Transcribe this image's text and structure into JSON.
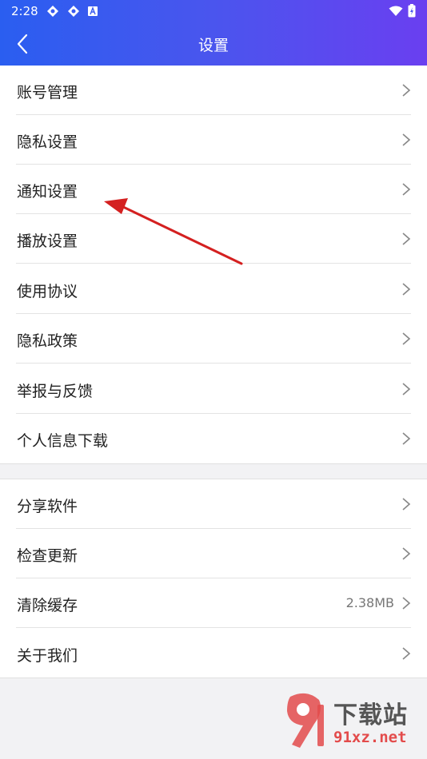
{
  "status_bar": {
    "time": "2:28",
    "icons": [
      "pinwheel-icon",
      "pinwheel-icon",
      "app-a-icon",
      "wifi-icon",
      "battery-charging-icon"
    ]
  },
  "header": {
    "title": "设置",
    "back_icon": "chevron-left-icon",
    "gradient": [
      "#2a5ef0",
      "#6a3ff0"
    ]
  },
  "group1": [
    {
      "label": "账号管理"
    },
    {
      "label": "隐私设置"
    },
    {
      "label": "通知设置"
    },
    {
      "label": "播放设置"
    },
    {
      "label": "使用协议"
    },
    {
      "label": "隐私政策"
    },
    {
      "label": "举报与反馈"
    },
    {
      "label": "个人信息下载"
    }
  ],
  "group2": [
    {
      "label": "分享软件"
    },
    {
      "label": "检查更新"
    },
    {
      "label": "清除缓存",
      "value": "2.38MB"
    },
    {
      "label": "关于我们"
    }
  ],
  "annotation": {
    "type": "red-arrow",
    "color": "#d42020",
    "points_to": "通知设置"
  },
  "watermark": {
    "title": "下载站",
    "url": "91xz.net",
    "logo": "91-logo"
  }
}
